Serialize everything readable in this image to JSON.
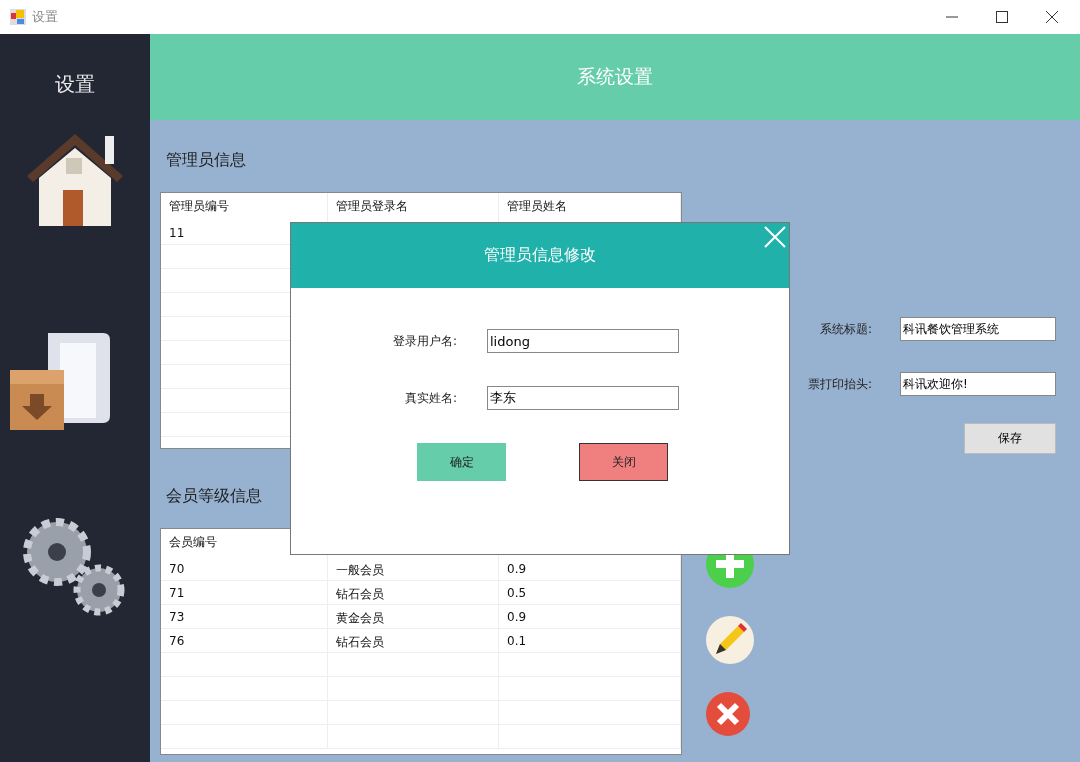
{
  "window": {
    "title": "设置"
  },
  "sidebar": {
    "title": "设置"
  },
  "header": {
    "title": "系统设置"
  },
  "admin_section": {
    "title": "管理员信息",
    "columns": [
      "管理员编号",
      "管理员登录名",
      "管理员姓名"
    ],
    "rows": [
      [
        "11"
      ]
    ]
  },
  "member_section": {
    "title": "会员等级信息",
    "columns": [
      "会员编号"
    ],
    "rows": [
      [
        "70",
        "一般会员",
        "0.9"
      ],
      [
        "71",
        "钻石会员",
        "0.5"
      ],
      [
        "73",
        "黄金会员",
        "0.9"
      ],
      [
        "76",
        "钻石会员",
        "0.1"
      ]
    ]
  },
  "settings_form": {
    "fields": [
      {
        "label": "系统标题:",
        "value": "科讯餐饮管理系统"
      },
      {
        "label": "票打印抬头:",
        "value": "科讯欢迎你!"
      }
    ],
    "button": "保存"
  },
  "dialog": {
    "title": "管理员信息修改",
    "fields": [
      {
        "label": "登录用户名:",
        "value": "lidong"
      },
      {
        "label": "真实姓名:",
        "value": "李东"
      }
    ],
    "buttons": [
      {
        "kind": "confirm",
        "label": "确定"
      },
      {
        "kind": "close",
        "label": "关闭"
      }
    ]
  }
}
